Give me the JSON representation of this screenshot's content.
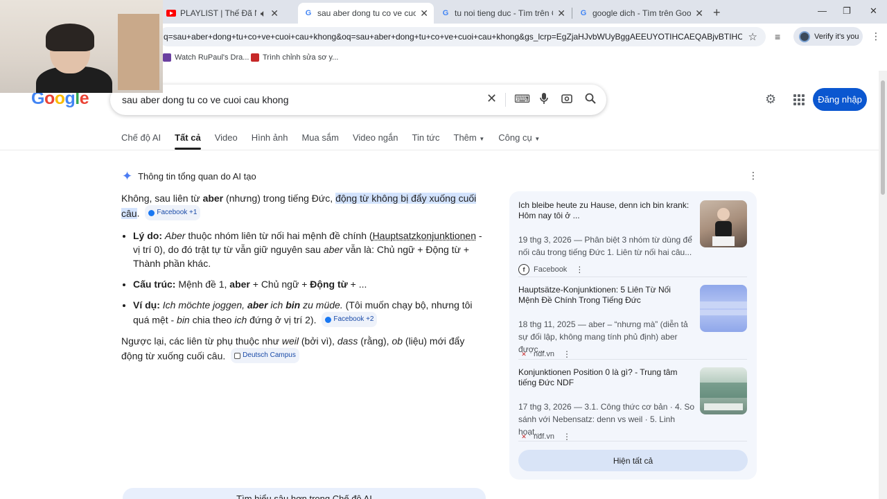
{
  "browser": {
    "tabs": [
      {
        "title": "PLAYLIST | Thế Đã Nghe Nhạc",
        "icon": "youtube-icon"
      },
      {
        "title": "sau aber dong tu co ve cuoi cau",
        "icon": "google-icon"
      },
      {
        "title": "tu noi tieng duc - Tìm trên Goo",
        "icon": "google-icon"
      },
      {
        "title": "google dich - Tìm trên Google",
        "icon": "google-icon"
      }
    ],
    "url": "q=sau+aber+dong+tu+co+ve+cuoi+cau+khong&oq=sau+aber+dong+tu+co+ve+cuoi+cau+khong&gs_lcrp=EgZjaHJvbWUyBggAEEUYOTIHCAEQABjvBTIHCA...",
    "profile_label": "Verify it's you",
    "bookmarks": [
      {
        "label": "Watch RuPaul's Dra...",
        "color": "#6a3fa0"
      },
      {
        "label": "Trình chỉnh sửa sơ y...",
        "color": "#c62828"
      }
    ]
  },
  "google": {
    "logo_letters": [
      {
        "ch": "G",
        "color": "#4285f4"
      },
      {
        "ch": "o",
        "color": "#ea4335"
      },
      {
        "ch": "o",
        "color": "#fbbc05"
      },
      {
        "ch": "g",
        "color": "#4285f4"
      },
      {
        "ch": "l",
        "color": "#34a853"
      },
      {
        "ch": "e",
        "color": "#ea4335"
      }
    ],
    "query": "sau aber dong tu co ve cuoi cau khong",
    "signin_label": "Đăng nhập",
    "nav": {
      "ai_mode": "Chế độ AI",
      "all": "Tất cả",
      "videos": "Video",
      "images": "Hình ảnh",
      "shopping": "Mua sắm",
      "short_videos": "Video ngắn",
      "news": "Tin tức",
      "more": "Thêm",
      "tools": "Công cụ"
    }
  },
  "ai_overview": {
    "heading": "Thông tin tổng quan do AI tạo",
    "intro_a": "Không, sau liên từ ",
    "intro_b": "aber",
    "intro_c": " (nhưng) trong tiếng Đức, ",
    "intro_hl": "động từ không bị đẩy xuống cuối câu",
    "intro_end": ".",
    "intro_chip": "Facebook +1",
    "b1_label": "Lý do:",
    "b1_aber": "Aber",
    "b1_text": " thuộc nhóm liên từ nối hai mệnh đề chính (",
    "b1_link": "Hauptsatzkonjunktionen",
    "b1_text2": " - vị trí 0), do đó trật tự từ vẫn giữ nguyên sau ",
    "b1_aber2": "aber",
    "b1_text3": " vẫn là: Chủ ngữ + Động từ + Thành phần khác.",
    "b2_label": "Cấu trúc:",
    "b2_a": " Mệnh đề 1, ",
    "b2_aber": "aber",
    "b2_b": " + Chủ ngữ + ",
    "b2_verb": "Động từ",
    "b2_c": " + ...",
    "b3_label": "Ví dụ:",
    "b3_ex1": " Ich möchte joggen, ",
    "b3_aber": "aber",
    "b3_ich": " ich ",
    "b3_bin": "bin",
    "b3_ex2": " zu müde.",
    "b3_tr": " (Tôi muốn chạy bộ, nhưng tôi quá mệt - ",
    "b3_bin2": "bin",
    "b3_tr2": " chia theo ",
    "b3_ich2": "ich",
    "b3_tr3": " đứng ở vị trí 2).",
    "b3_chip": "Facebook +2",
    "p2_a": "Ngược lại, các liên từ phụ thuộc như ",
    "p2_weil": "weil",
    "p2_b": " (bởi vì), ",
    "p2_dass": "dass",
    "p2_c": " (rằng), ",
    "p2_ob": "ob",
    "p2_d": " (liệu) mới đẩy động từ xuống cuối câu.",
    "p2_chip": "Deutsch Campus",
    "deep_dive": "Tìm hiểu sâu hơn trong Chế độ AI"
  },
  "sources": [
    {
      "title": "Ich bleibe heute zu Hause, denn ich bin krank: Hôm nay tôi ở ...",
      "desc": "19 thg 3, 2026 — Phân biệt 3 nhóm từ dùng để nối câu trong tiếng Đức 1. Liên từ nối hai câu...",
      "site": "Facebook"
    },
    {
      "title": "Hauptsätze-Konjunktionen: 5 Liên Từ Nối Mệnh Đề Chính Trong Tiếng Đức",
      "desc": "18 thg 11, 2025 — aber – “nhưng mà” (diễn tả sự đối lập, không mang tính phủ định) aber được...",
      "site": "ndf.vn"
    },
    {
      "title": "Konjunktionen Position 0 là gì? - Trung tâm tiếng Đức NDF",
      "desc": "17 thg 3, 2026 — 3.1. Công thức cơ bản · 4. So sánh với Nebensatz: denn vs weil · 5. Linh hoạt...",
      "site": "ndf.vn"
    }
  ],
  "show_all": "Hiện tất cả"
}
